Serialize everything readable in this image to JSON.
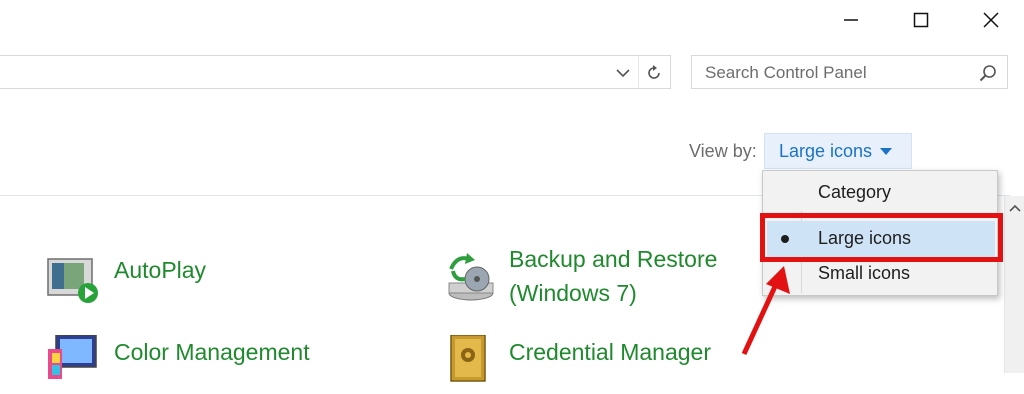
{
  "window_controls": {
    "minimize": "minimize-icon",
    "maximize": "maximize-icon",
    "close": "close-icon"
  },
  "address_bar": {
    "value": ""
  },
  "search": {
    "placeholder": "Search Control Panel"
  },
  "view_by": {
    "label": "View by:",
    "value": "Large icons"
  },
  "menu": {
    "options": [
      "Category",
      "Large icons",
      "Small icons"
    ],
    "selected": "Large icons"
  },
  "items": [
    {
      "label": "AutoPlay",
      "icon": "autoplay-icon"
    },
    {
      "label_line1": "Backup and Restore",
      "label_line2": "(Windows 7)",
      "icon": "backup-restore-icon"
    },
    {
      "label": "Color Management",
      "icon": "color-management-icon"
    },
    {
      "label": "Credential Manager",
      "icon": "credential-manager-icon"
    }
  ],
  "colors": {
    "link_green": "#1f8a2d",
    "accent_blue": "#1a73c8",
    "annotation_red": "#e21212"
  }
}
